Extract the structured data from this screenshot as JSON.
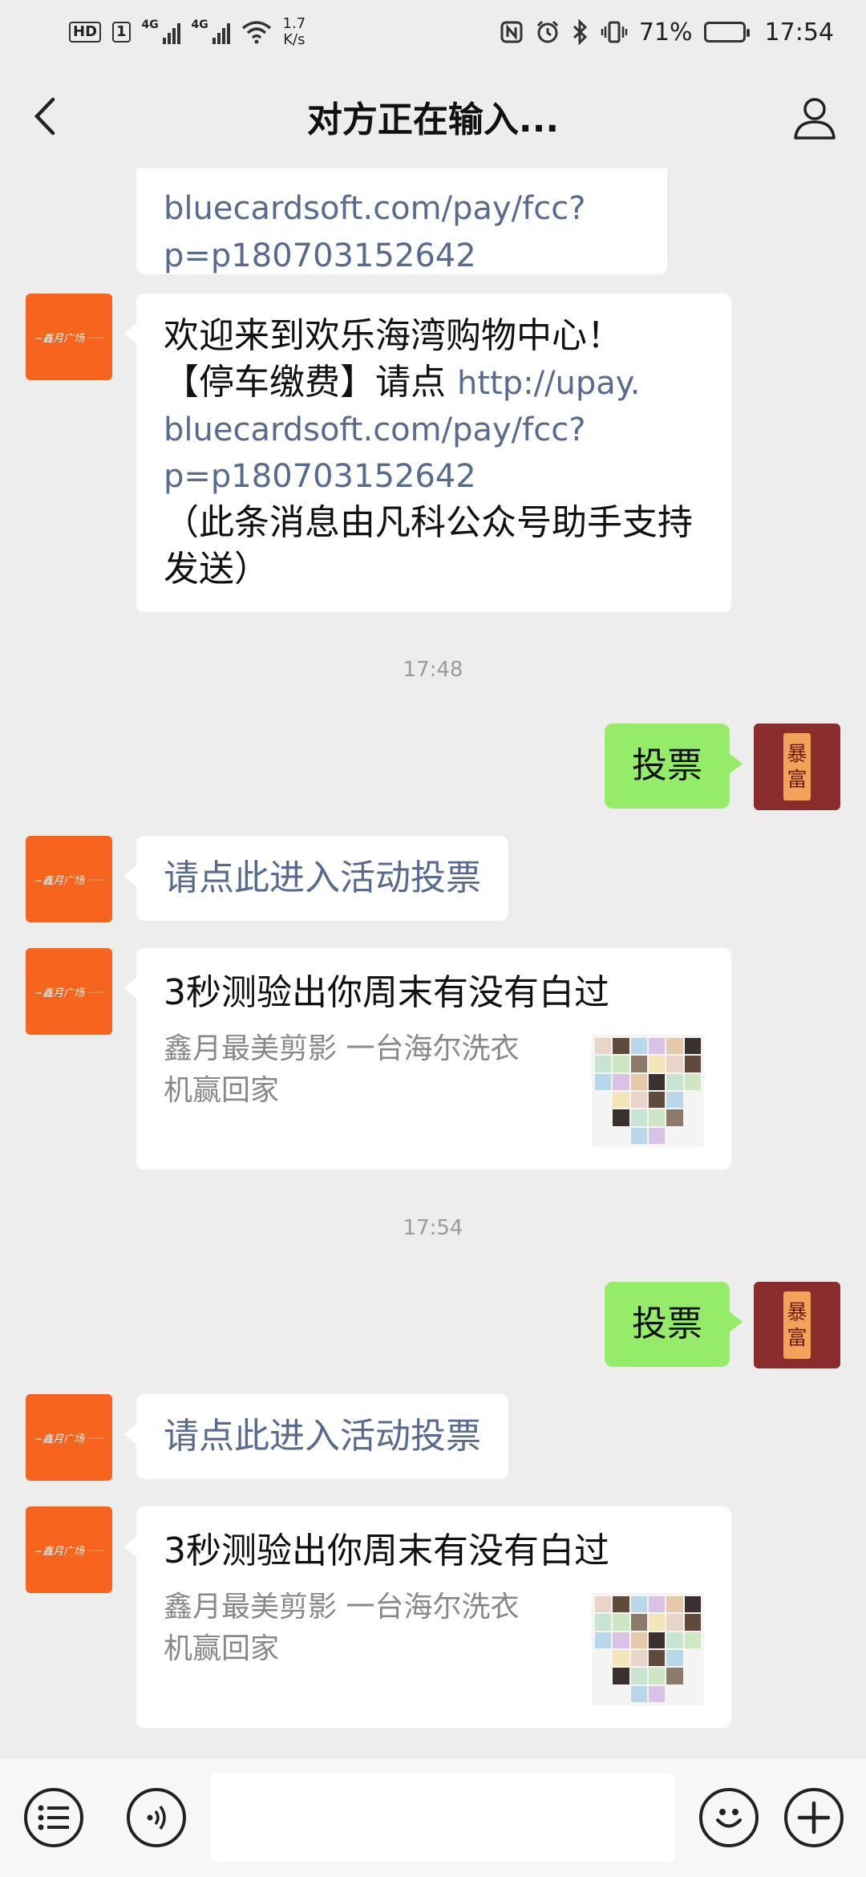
{
  "status_bar": {
    "hd_label": "HD",
    "sim_label": "1",
    "net1": "4G",
    "net2": "4G",
    "speed_value": "1.7",
    "speed_unit": "K/s",
    "battery_percent": "71%",
    "battery_level": 0.71,
    "time": "17:54"
  },
  "nav": {
    "title": "对方正在输入..."
  },
  "messages": {
    "m1": {
      "link_line1": "bluecardsoft.com/pay/fcc?",
      "link_line2": "p=p180703152642"
    },
    "m2": {
      "line1": "欢迎来到欢乐海湾购物中心！",
      "line2_prefix": "【停车缴费】请点 ",
      "link1": "http://upay.",
      "link2": "bluecardsoft.com/pay/fcc?",
      "link3": "p=p180703152642",
      "line5": "（此条消息由凡科公众号助手支持",
      "line6": "发送）"
    },
    "time1": "17:48",
    "vote1": "投票",
    "action1": "请点此进入活动投票",
    "card1": {
      "title": "3秒测验出你周末有没有白过",
      "desc_line1": "鑫月最美剪影 一台海尔洗衣",
      "desc_line2": "机赢回家"
    },
    "time2": "17:54",
    "vote2": "投票",
    "action2": "请点此进入活动投票",
    "card2": {
      "title": "3秒测验出你周末有没有白过",
      "desc_line1": "鑫月最美剪影 一台海尔洗衣",
      "desc_line2": "机赢回家"
    }
  },
  "avatars": {
    "me_top": "暴",
    "me_bottom": "富"
  },
  "input_bar": {
    "text": ""
  },
  "icons": [
    "back-icon",
    "user-icon",
    "list-menu-icon",
    "voice-icon",
    "emoji-icon",
    "plus-icon"
  ],
  "colors": {
    "my_bubble": "#95ec69",
    "merchant_avatar": "#f7641e",
    "link": "#586b8f",
    "background": "#ededed"
  }
}
